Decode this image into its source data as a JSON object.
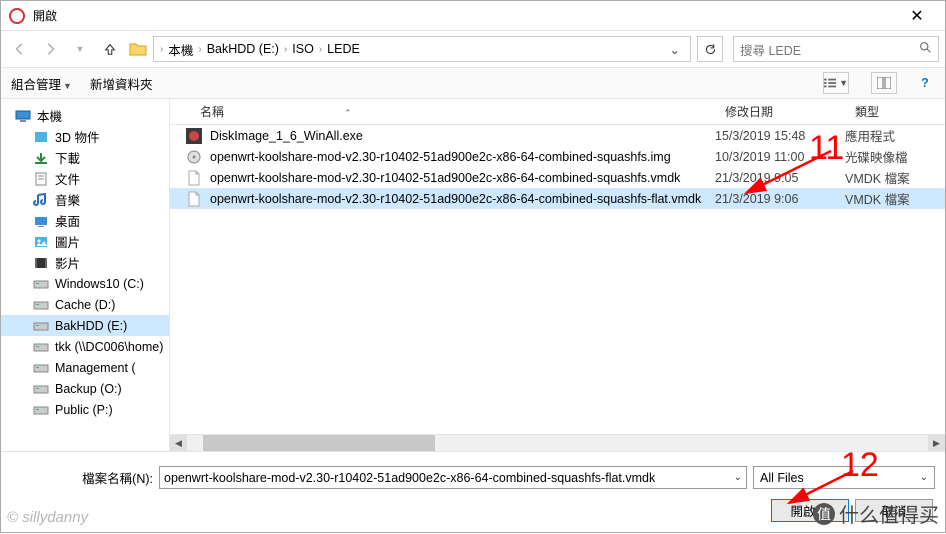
{
  "title": "開啟",
  "breadcrumb": {
    "c0": "本機",
    "c1": "BakHDD (E:)",
    "c2": "ISO",
    "c3": "LEDE"
  },
  "search_placeholder": "搜尋 LEDE",
  "toolbar": {
    "organize": "組合管理",
    "newfolder": "新增資料夾"
  },
  "columns": {
    "name": "名稱",
    "date": "修改日期",
    "type": "類型"
  },
  "sidebar": {
    "root": "本機",
    "items": [
      "3D 物件",
      "下載",
      "文件",
      "音樂",
      "桌面",
      "圖片",
      "影片",
      "Windows10 (C:)",
      "Cache (D:)",
      "BakHDD (E:)",
      "tkk (\\\\DC006\\home)",
      "Management (",
      "Backup (O:)",
      "Public (P:)"
    ]
  },
  "files": [
    {
      "name": "DiskImage_1_6_WinAll.exe",
      "date": "15/3/2019 15:48",
      "type": "應用程式",
      "icon": "exe"
    },
    {
      "name": "openwrt-koolshare-mod-v2.30-r10402-51ad900e2c-x86-64-combined-squashfs.img",
      "date": "10/3/2019 11:00",
      "type": "光碟映像檔",
      "icon": "img"
    },
    {
      "name": "openwrt-koolshare-mod-v2.30-r10402-51ad900e2c-x86-64-combined-squashfs.vmdk",
      "date": "21/3/2019 9:05",
      "type": "VMDK 檔案",
      "icon": "file"
    },
    {
      "name": "openwrt-koolshare-mod-v2.30-r10402-51ad900e2c-x86-64-combined-squashfs-flat.vmdk",
      "date": "21/3/2019 9:06",
      "type": "VMDK 檔案",
      "icon": "file"
    }
  ],
  "selected_index": 3,
  "filename_label": "檔案名稱(N):",
  "filename_value": "openwrt-koolshare-mod-v2.30-r10402-51ad900e2c-x86-64-combined-squashfs-flat.vmdk",
  "filter": "All Files",
  "buttons": {
    "open": "開啟",
    "cancel": "取消"
  },
  "annotations": {
    "n1": "11",
    "n2": "12"
  },
  "watermark": "© sillydanny",
  "watermark2": "什么值得买"
}
